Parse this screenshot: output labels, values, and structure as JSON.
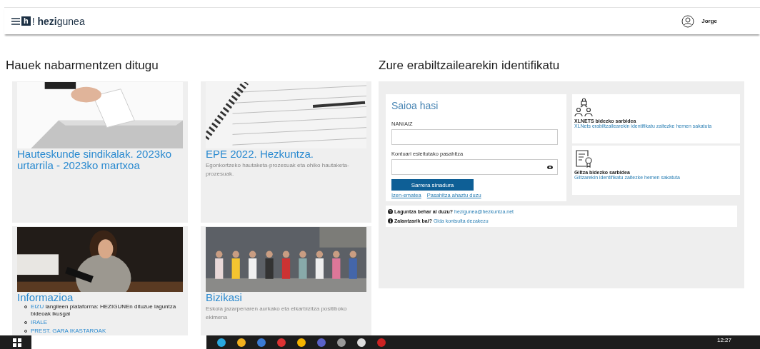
{
  "header": {
    "logo_mark": "h",
    "brand": "! **hezi**gunea",
    "user": "Jorge"
  },
  "highlights": {
    "title": "Hauek nabarmentzen ditugu",
    "cards": [
      {
        "kind": "vote",
        "title": "Hauteskunde sindikalak. 2023ko urtarrila - 2023ko martxoa"
      },
      {
        "kind": "notebook",
        "title": "EPE 2022. Hezkuntza.",
        "description": "Egonkortzeko hautaketa-prozesuak eta ohiko hautaketa-prozesuak."
      },
      {
        "kind": "person",
        "title": "Informazioa",
        "items": [
          {
            "link": "EIZU",
            "text": "langileen plataforma: HEZIGUNEn dituzue laguntza bideoak ikusgai"
          },
          {
            "link": "IRALE"
          },
          {
            "link": "PREST. GARA IKASTAROAK"
          }
        ]
      },
      {
        "kind": "crowd",
        "title": "Bizikasi",
        "description": "Eskola jazarpenaren aurkako eta elkarbizitza positiboko ekimena"
      }
    ]
  },
  "login": {
    "title": "Zure erabiltzailearekin identifikatu",
    "form_title": "Saioa hasi",
    "fields": [
      {
        "kind": "text",
        "label": "NAN/AIZ"
      },
      {
        "kind": "password",
        "label": "Kontuari esleitutako pasahitza"
      }
    ],
    "submit": "Sarrera sinadura",
    "links": [
      "Izen-ematea",
      "Pasahitza ahaztu duzu"
    ],
    "access": [
      {
        "kind": "network",
        "title": "XLNETS bidezko sarbidea",
        "link": "XLNets erabiltzailearekin identifikatu zaitezke hemen sakatuta"
      },
      {
        "kind": "certificate",
        "title": "Giltza bidezko sarbidea",
        "link": "Giltzarekin identifikatu zaitezke hemen sakatuta"
      }
    ],
    "help": [
      {
        "kind": "question",
        "label": "Laguntza behar al duzu?",
        "link": "hezigunea@hezkuntza.net"
      },
      {
        "kind": "info",
        "label": "Zalantzarik bai?",
        "link": "Gida kontsulta dezakezu"
      }
    ]
  },
  "taskbar": {
    "clock": "12:27"
  }
}
